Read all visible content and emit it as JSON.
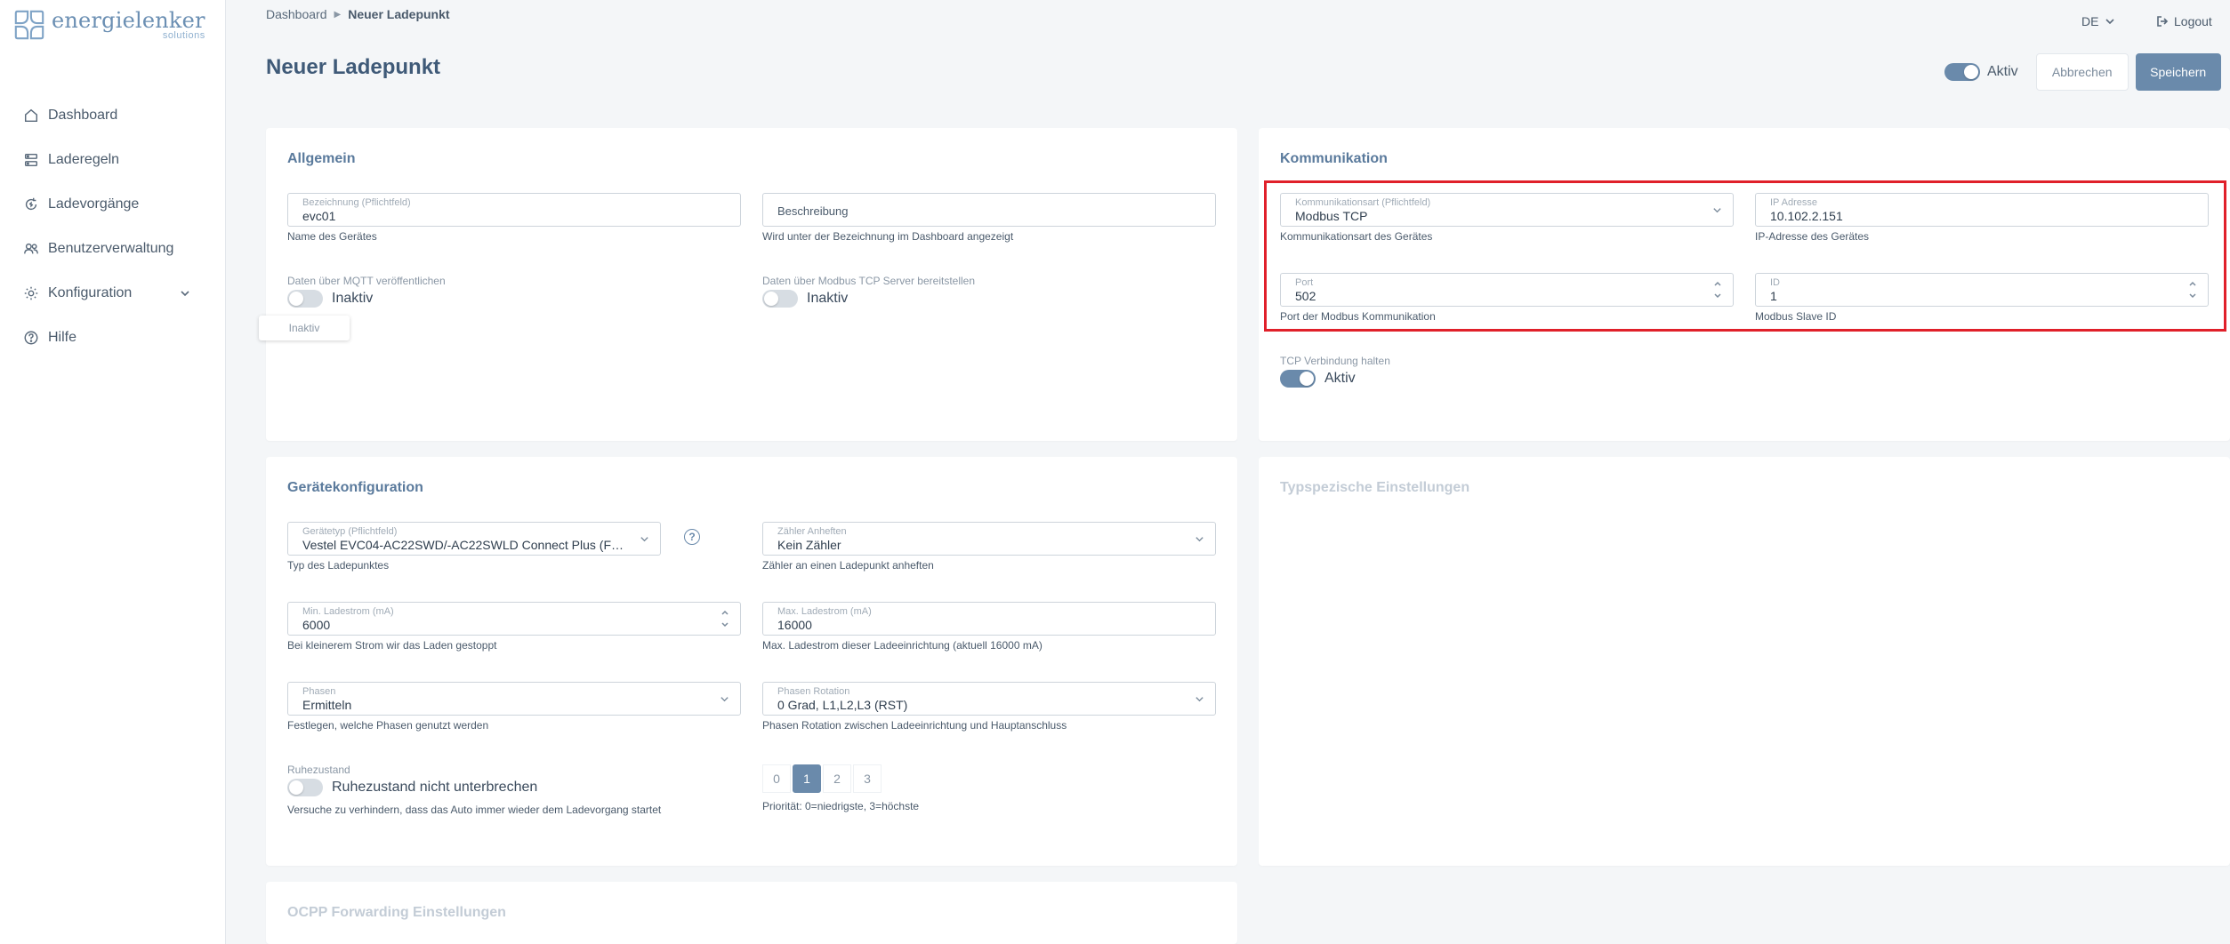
{
  "brand": {
    "name": "energielenker",
    "sub": "solutions"
  },
  "sidebar": {
    "items": [
      {
        "label": "Dashboard",
        "icon": "home-icon"
      },
      {
        "label": "Laderegeln",
        "icon": "rules-icon"
      },
      {
        "label": "Ladevorgänge",
        "icon": "refresh-icon"
      },
      {
        "label": "Benutzerverwaltung",
        "icon": "users-icon"
      },
      {
        "label": "Konfiguration",
        "icon": "gear-icon"
      },
      {
        "label": "Hilfe",
        "icon": "help-icon"
      }
    ]
  },
  "topbar": {
    "breadcrumb_home": "Dashboard",
    "breadcrumb_current": "Neuer Ladepunkt",
    "lang": "DE",
    "logout": "Logout"
  },
  "page": {
    "title": "Neuer Ladepunkt",
    "active_label": "Aktiv",
    "active": true,
    "cancel_label": "Abbrechen",
    "save_label": "Speichern"
  },
  "general": {
    "title": "Allgemein",
    "name_label": "Bezeichnung (Pflichtfeld)",
    "name_value": "evc01",
    "name_hint": "Name des Gerätes",
    "desc_placeholder": "Beschreibung",
    "desc_hint": "Wird unter der Bezeichnung im Dashboard angezeigt",
    "mqtt_label": "Daten über MQTT veröffentlichen",
    "mqtt_state": "Inaktiv",
    "modbus_label": "Daten über Modbus TCP Server bereitstellen",
    "modbus_state": "Inaktiv",
    "tooltip": "Inaktiv"
  },
  "communication": {
    "title": "Kommunikation",
    "type_label": "Kommunikationsart (Pflichtfeld)",
    "type_value": "Modbus TCP",
    "type_hint": "Kommunikationsart des Gerätes",
    "ip_label": "IP Adresse",
    "ip_value": "10.102.2.151",
    "ip_hint": "IP-Adresse des Gerätes",
    "port_label": "Port",
    "port_value": "502",
    "port_hint": "Port der Modbus Kommunikation",
    "id_label": "ID",
    "id_value": "1",
    "id_hint": "Modbus Slave ID",
    "tcp_label": "TCP Verbindung halten",
    "tcp_state": "Aktiv"
  },
  "device": {
    "title": "Gerätekonfiguration",
    "type_label": "Gerätetyp (Pflichtfeld)",
    "type_value": "Vestel EVC04-AC22SWD/-AC22SWLD Connect Plus (FW:...",
    "type_hint": "Typ des Ladepunktes",
    "meter_label": "Zähler Anheften",
    "meter_value": "Kein Zähler",
    "meter_hint": "Zähler an einen Ladepunkt anheften",
    "min_label": "Min. Ladestrom (mA)",
    "min_value": "6000",
    "min_hint": "Bei kleinerem Strom wir das Laden gestoppt",
    "max_label": "Max. Ladestrom (mA)",
    "max_value": "16000",
    "max_hint": "Max. Ladestrom dieser Ladeeinrichtung (aktuell 16000 mA)",
    "phases_label": "Phasen",
    "phases_value": "Ermitteln",
    "phases_hint": "Festlegen, welche Phasen genutzt werden",
    "rotation_label": "Phasen Rotation",
    "rotation_value": "0 Grad, L1,L2,L3 (RST)",
    "rotation_hint": "Phasen Rotation zwischen Ladeeinrichtung und Hauptanschluss",
    "idle_label": "Ruhezustand",
    "idle_toggle_label": "Ruhezustand nicht unterbrechen",
    "idle_hint": "Versuche zu verhindern, dass das Auto immer wieder dem Ladevorgang startet",
    "priority": [
      "0",
      "1",
      "2",
      "3"
    ],
    "priority_selected": "1",
    "priority_hint": "Priorität: 0=niedrigste, 3=höchste"
  },
  "typespecific": {
    "title": "Typspezische Einstellungen"
  },
  "ocpp": {
    "title": "OCPP Forwarding Einstellungen"
  }
}
